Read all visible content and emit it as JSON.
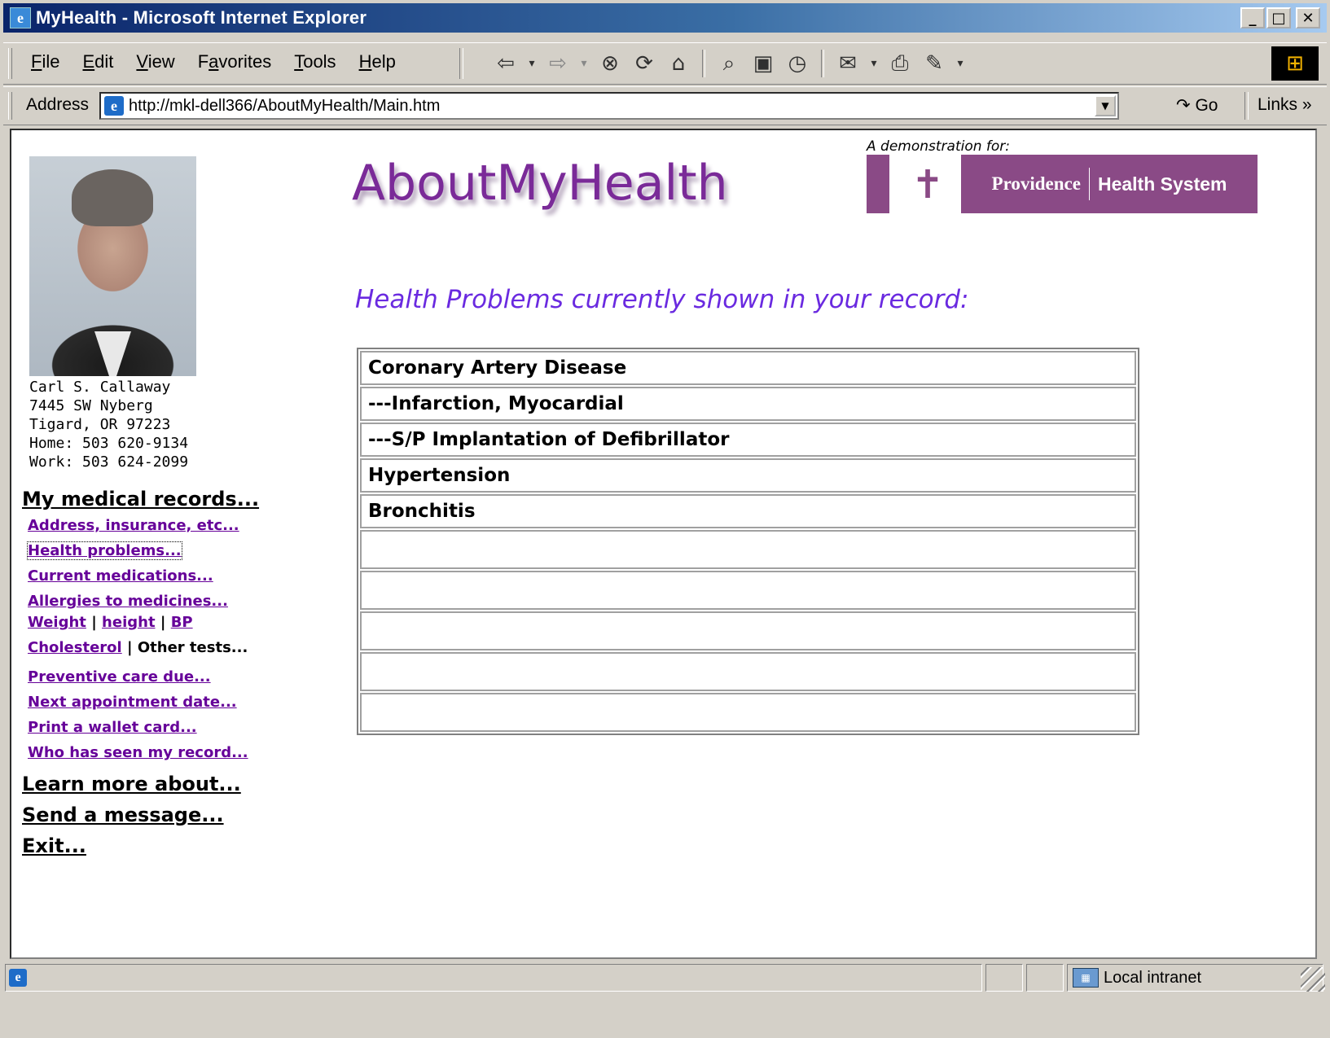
{
  "window": {
    "title": "MyHealth - Microsoft Internet Explorer",
    "buttons": {
      "minimize": "_",
      "maximize": "□",
      "close": "✕"
    }
  },
  "menu": [
    {
      "key": "F",
      "rest": "ile"
    },
    {
      "key": "E",
      "rest": "dit"
    },
    {
      "key": "V",
      "rest": "iew"
    },
    {
      "pre": "F",
      "key": "a",
      "rest": "vorites"
    },
    {
      "key": "T",
      "rest": "ools"
    },
    {
      "key": "H",
      "rest": "elp"
    }
  ],
  "toolbar_icons": [
    "back-icon",
    "forward-icon",
    "stop-icon",
    "refresh-icon",
    "home-icon",
    "search-icon",
    "favorites-icon",
    "history-icon",
    "mail-icon",
    "print-icon",
    "edit-icon"
  ],
  "address": {
    "label": "Address",
    "url": "http://mkl-dell366/AboutMyHealth/Main.htm",
    "go": "Go",
    "links": "Links"
  },
  "patient": {
    "name": "Carl S. Callaway",
    "street": "7445 SW Nyberg",
    "city": "Tigard, OR 97223",
    "home": "Home: 503 620-9134",
    "work": "Work: 503 624-2099"
  },
  "nav": {
    "my_records": "My medical records...",
    "address": "Address, insurance, etc...",
    "health_problems": "Health problems...",
    "medications": "Current medications...",
    "allergies": "Allergies to medicines...",
    "weight": "Weight",
    "height": "height",
    "bp": "BP",
    "cholesterol": "Cholesterol",
    "other_tests": "Other tests...",
    "preventive": "Preventive care due...",
    "next_appt": "Next appointment date...",
    "wallet": "Print a wallet card...",
    "who_seen": "Who has seen my record...",
    "learn_more": "Learn more about...",
    "send_message": "Send a message...",
    "exit": "Exit...",
    "separator": "|"
  },
  "brand": {
    "logo": "AboutMyHealth",
    "demo_for": "A demonstration for:",
    "providence": "Providence",
    "health_system": "Health System"
  },
  "main": {
    "heading": "Health Problems currently shown in your record:",
    "problems": [
      "Coronary Artery Disease",
      "---Infarction, Myocardial",
      "---S/P Implantation of Defibrillator",
      "Hypertension",
      "Bronchitis",
      "",
      "",
      "",
      "",
      ""
    ]
  },
  "status": {
    "zone": "Local intranet"
  },
  "colors": {
    "link_visited": "#660099",
    "heading": "#6a2ae0",
    "brand_purple": "#8a4a86",
    "logo": "#7a2a98"
  }
}
